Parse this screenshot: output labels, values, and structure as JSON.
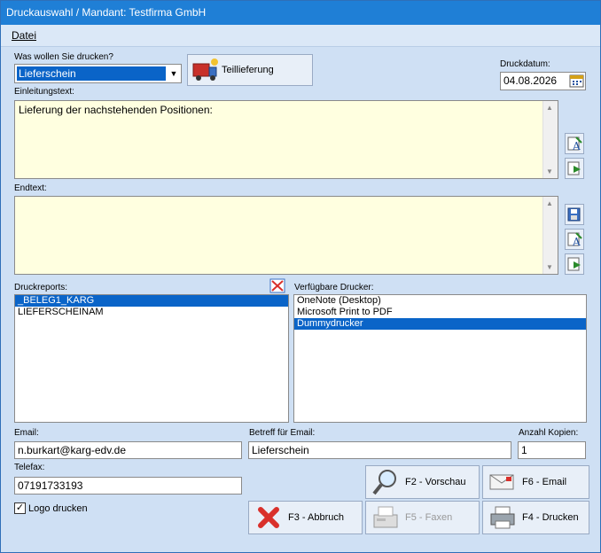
{
  "window": {
    "title": "Druckauswahl / Mandant: Testfirma GmbH"
  },
  "menu": {
    "file": "Datei"
  },
  "print_what": {
    "label": "Was wollen Sie drucken?",
    "value": "Lieferschein"
  },
  "partial_button": {
    "label": "Teillieferung"
  },
  "print_date": {
    "label": "Druckdatum:",
    "value": "04.08.2026"
  },
  "intro": {
    "label": "Einleitungstext:",
    "value": "Lieferung der nachstehenden Positionen:"
  },
  "end": {
    "label": "Endtext:",
    "value": ""
  },
  "reports": {
    "label": "Druckreports:",
    "items": [
      "_BELEG1_KARG",
      "LIEFERSCHEINAM"
    ],
    "selected_index": 0
  },
  "printers": {
    "label": "Verfügbare Drucker:",
    "items": [
      "OneNote (Desktop)",
      "Microsoft Print to PDF",
      "Dummydrucker"
    ],
    "selected_index": 2
  },
  "email": {
    "label": "Email:",
    "value": "n.burkart@karg-edv.de"
  },
  "subject": {
    "label": "Betreff für Email:",
    "value": "Lieferschein"
  },
  "copies": {
    "label": "Anzahl Kopien:",
    "value": "1"
  },
  "fax": {
    "label": "Telefax:",
    "value": "07191733193"
  },
  "logo": {
    "label": "Logo drucken",
    "checked": true
  },
  "buttons": {
    "preview": "F2 - Vorschau",
    "email": "F6 - Email",
    "cancel": "F3 - Abbruch",
    "fax": "F5 - Faxen",
    "print": "F4 - Drucken"
  },
  "icons": {
    "partial": "truck-person-icon",
    "calendar": "calendar-icon",
    "edit": "edit-text-icon",
    "insert": "insert-icon",
    "save": "save-text-icon",
    "delete_report": "delete-report-icon",
    "preview": "magnifier-icon",
    "email": "envelope-icon",
    "cancel": "red-x-icon",
    "fax": "fax-icon",
    "print": "printer-icon"
  },
  "colors": {
    "accent": "#1f7fd6",
    "selection": "#0a64c8",
    "memo_background": "#ffffe0",
    "cancel_red": "#d9302b"
  }
}
